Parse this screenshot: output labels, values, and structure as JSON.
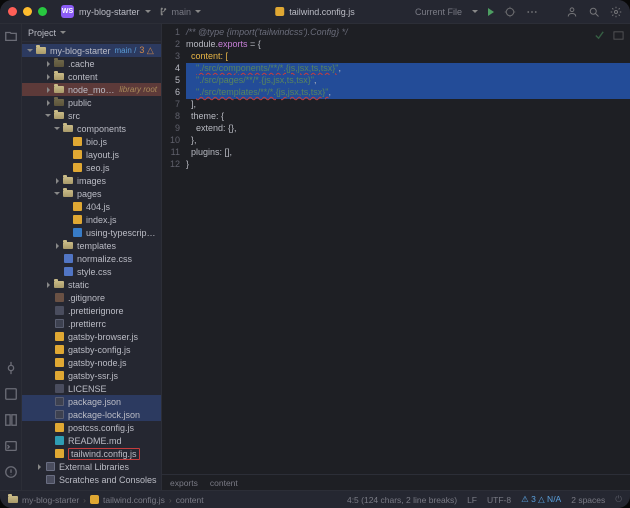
{
  "titlebar": {
    "project_name": "my-blog-starter",
    "branch_label": "main",
    "tab_filename": "tailwind.config.js",
    "run_config": "Current File"
  },
  "project_panel": {
    "title": "Project",
    "root": {
      "name": "my-blog-starter",
      "vcs": "main",
      "changes": "3"
    },
    "tree": [
      {
        "d": 1,
        "t": "folder",
        "exp": "h",
        "name": ".cache",
        "dim": true
      },
      {
        "d": 1,
        "t": "folder",
        "exp": "h",
        "name": "content"
      },
      {
        "d": 1,
        "t": "folder",
        "exp": "h",
        "name": "node_modules",
        "extra": "library root",
        "row": "nm"
      },
      {
        "d": 1,
        "t": "folder",
        "exp": "h",
        "name": "public",
        "dim": true
      },
      {
        "d": 1,
        "t": "folder",
        "exp": "v",
        "name": "src"
      },
      {
        "d": 2,
        "t": "folder",
        "exp": "v",
        "name": "components"
      },
      {
        "d": 3,
        "t": "js",
        "name": "bio.js"
      },
      {
        "d": 3,
        "t": "js",
        "name": "layout.js"
      },
      {
        "d": 3,
        "t": "js",
        "name": "seo.js"
      },
      {
        "d": 2,
        "t": "folder",
        "exp": "h",
        "name": "images"
      },
      {
        "d": 2,
        "t": "folder",
        "exp": "v",
        "name": "pages"
      },
      {
        "d": 3,
        "t": "js",
        "name": "404.js"
      },
      {
        "d": 3,
        "t": "js",
        "name": "index.js"
      },
      {
        "d": 3,
        "t": "ts",
        "name": "using-typescript.tsx"
      },
      {
        "d": 2,
        "t": "folder",
        "exp": "h",
        "name": "templates"
      },
      {
        "d": 2,
        "t": "css",
        "name": "normalize.css"
      },
      {
        "d": 2,
        "t": "css",
        "name": "style.css"
      },
      {
        "d": 1,
        "t": "folder",
        "exp": "h",
        "name": "static"
      },
      {
        "d": 1,
        "t": "git",
        "name": ".gitignore"
      },
      {
        "d": 1,
        "t": "txt",
        "name": ".prettierignore"
      },
      {
        "d": 1,
        "t": "json",
        "name": ".prettierrc"
      },
      {
        "d": 1,
        "t": "js",
        "name": "gatsby-browser.js"
      },
      {
        "d": 1,
        "t": "js",
        "name": "gatsby-config.js"
      },
      {
        "d": 1,
        "t": "js",
        "name": "gatsby-node.js"
      },
      {
        "d": 1,
        "t": "js",
        "name": "gatsby-ssr.js"
      },
      {
        "d": 1,
        "t": "txt",
        "name": "LICENSE"
      },
      {
        "d": 1,
        "t": "json",
        "name": "package.json",
        "row": "hl"
      },
      {
        "d": 1,
        "t": "json",
        "name": "package-lock.json",
        "row": "hl"
      },
      {
        "d": 1,
        "t": "js",
        "name": "postcss.config.js"
      },
      {
        "d": 1,
        "t": "md",
        "name": "README.md"
      },
      {
        "d": 1,
        "t": "js",
        "name": "tailwind.config.js",
        "row": "sel"
      },
      {
        "d": 0,
        "t": "lib",
        "exp": "h",
        "name": "External Libraries"
      },
      {
        "d": 0,
        "t": "lib",
        "name": "Scratches and Consoles"
      }
    ]
  },
  "editor": {
    "lines": [
      {
        "n": 1,
        "seg": [
          {
            "c": "tok-comment",
            "t": "/** @type {import('tailwindcss').Config} */"
          }
        ]
      },
      {
        "n": 2,
        "seg": [
          {
            "c": "tok-plain",
            "t": "module."
          },
          {
            "c": "tok-key",
            "t": "exports"
          },
          {
            "c": "tok-plain",
            "t": " = {"
          }
        ]
      },
      {
        "n": 3,
        "seg": [
          {
            "c": "tok-plain",
            "t": "  "
          },
          {
            "c": "bracket",
            "t": "content: ["
          }
        ]
      },
      {
        "n": 4,
        "sel": true,
        "seg": [
          {
            "c": "tok-plain",
            "t": "    "
          },
          {
            "c": "tok-str underline-red",
            "t": "\"./src/components/**/*.{js,jsx,ts,tsx}\""
          },
          {
            "c": "tok-plain",
            "t": ","
          }
        ]
      },
      {
        "n": 5,
        "sel": true,
        "seg": [
          {
            "c": "tok-plain",
            "t": "    "
          },
          {
            "c": "tok-str",
            "t": "\"./src/pages/**/*.{js,jsx,ts,tsx}\""
          },
          {
            "c": "tok-plain",
            "t": ","
          }
        ]
      },
      {
        "n": 6,
        "sel": true,
        "seg": [
          {
            "c": "tok-plain",
            "t": "    "
          },
          {
            "c": "tok-str underline-red",
            "t": "\"./src/templates/**/*.{js,jsx,ts,tsx}\""
          },
          {
            "c": "tok-plain",
            "t": ","
          }
        ]
      },
      {
        "n": 7,
        "seg": [
          {
            "c": "tok-plain",
            "t": "  ],"
          }
        ]
      },
      {
        "n": 8,
        "seg": [
          {
            "c": "tok-plain",
            "t": "  theme: {"
          }
        ]
      },
      {
        "n": 9,
        "seg": [
          {
            "c": "tok-plain",
            "t": "    extend: {},"
          }
        ]
      },
      {
        "n": 10,
        "seg": [
          {
            "c": "tok-plain",
            "t": "  },"
          }
        ]
      },
      {
        "n": 11,
        "seg": [
          {
            "c": "tok-plain",
            "t": "  plugins: [],"
          }
        ]
      },
      {
        "n": 12,
        "seg": [
          {
            "c": "tok-plain",
            "t": "}"
          }
        ]
      }
    ],
    "bottom_tabs": [
      "exports",
      "content"
    ]
  },
  "breadcrumbs": [
    "my-blog-starter",
    "tailwind.config.js",
    "content"
  ],
  "status": {
    "selection": "4:5 (124 chars, 2 line breaks)",
    "line_sep": "LF",
    "encoding": "UTF-8",
    "analysis": "3 △ N/A",
    "indent": "2 spaces"
  }
}
